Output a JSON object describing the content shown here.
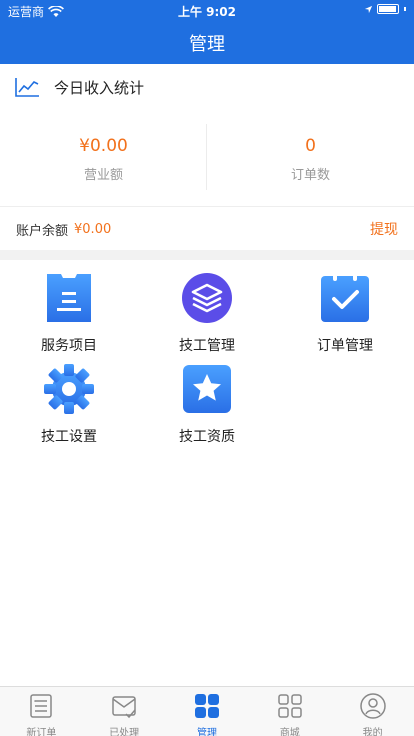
{
  "status_bar": {
    "carrier": "运营商",
    "time": "上午 9:02"
  },
  "nav": {
    "title": "管理"
  },
  "income": {
    "title": "今日收入统计",
    "revenue_value": "¥0.00",
    "revenue_label": "营业额",
    "orders_value": "0",
    "orders_label": "订单数"
  },
  "balance": {
    "label": "账户余额",
    "amount": "¥0.00",
    "withdraw": "提现"
  },
  "menu": [
    {
      "label": "服务项目",
      "icon": "service-list-icon"
    },
    {
      "label": "技工管理",
      "icon": "layers-icon"
    },
    {
      "label": "订单管理",
      "icon": "clipboard-check-icon"
    },
    {
      "label": "技工设置",
      "icon": "gear-icon"
    },
    {
      "label": "技工资质",
      "icon": "star-badge-icon"
    }
  ],
  "tabs": [
    {
      "label": "新订单",
      "icon": "list-icon"
    },
    {
      "label": "已处理",
      "icon": "envelope-check-icon"
    },
    {
      "label": "管理",
      "icon": "grid-icon"
    },
    {
      "label": "商城",
      "icon": "grid-outline-icon"
    },
    {
      "label": "我的",
      "icon": "user-icon"
    }
  ],
  "colors": {
    "primary": "#1f6fe0",
    "accent": "#f2711c",
    "icon_blue": "#3a86f7",
    "icon_purple": "#5b4de8"
  }
}
